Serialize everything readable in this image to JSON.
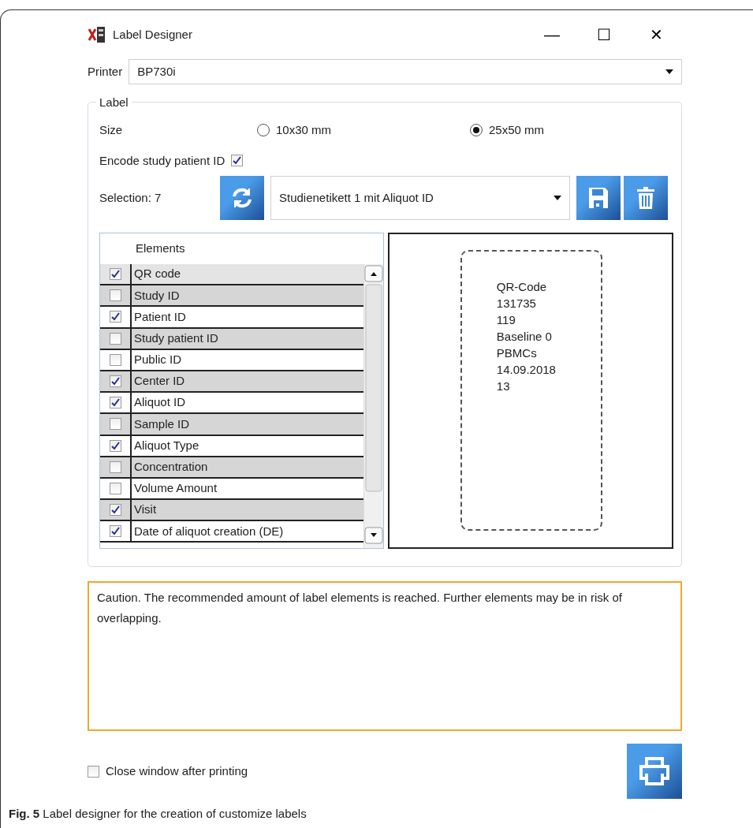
{
  "window": {
    "title": "Label Designer",
    "controls": [
      "—",
      "☐",
      "✕"
    ]
  },
  "printer": {
    "label": "Printer",
    "value": "BP730i"
  },
  "label_group": {
    "title": "Label",
    "size": {
      "label": "Size",
      "options": [
        {
          "label": "10x30 mm",
          "selected": false
        },
        {
          "label": "25x50 mm",
          "selected": true
        }
      ]
    },
    "encode": {
      "label": "Encode study patient ID",
      "checked": true
    },
    "selection": {
      "label": "Selection: 7",
      "template": "Studienetikett 1 mit Aliquot ID"
    },
    "elements": {
      "header": "Elements",
      "rows": [
        {
          "label": "QR code",
          "checked": true
        },
        {
          "label": "Study ID",
          "checked": false
        },
        {
          "label": "Patient ID",
          "checked": true
        },
        {
          "label": "Study patient ID",
          "checked": false
        },
        {
          "label": "Public ID",
          "checked": false
        },
        {
          "label": "Center ID",
          "checked": true
        },
        {
          "label": "Aliquot ID",
          "checked": true
        },
        {
          "label": "Sample ID",
          "checked": false
        },
        {
          "label": "Aliquot Type",
          "checked": true
        },
        {
          "label": "Concentration",
          "checked": false
        },
        {
          "label": "Volume Amount",
          "checked": false
        },
        {
          "label": "Visit",
          "checked": true
        },
        {
          "label": "Date of aliquot creation (DE)",
          "checked": true
        }
      ]
    },
    "preview": [
      "QR-Code",
      "131735",
      "119",
      "Baseline 0",
      "PBMCs",
      "14.09.2018",
      "13"
    ]
  },
  "message": "Caution. The recommended amount of label elements is reached. Further elements may be in risk of overlapping.",
  "close_after_printing": {
    "label": "Close window after printing",
    "checked": false
  },
  "caption": "**Fig. 5** Label designer for the creation of customize labels"
}
